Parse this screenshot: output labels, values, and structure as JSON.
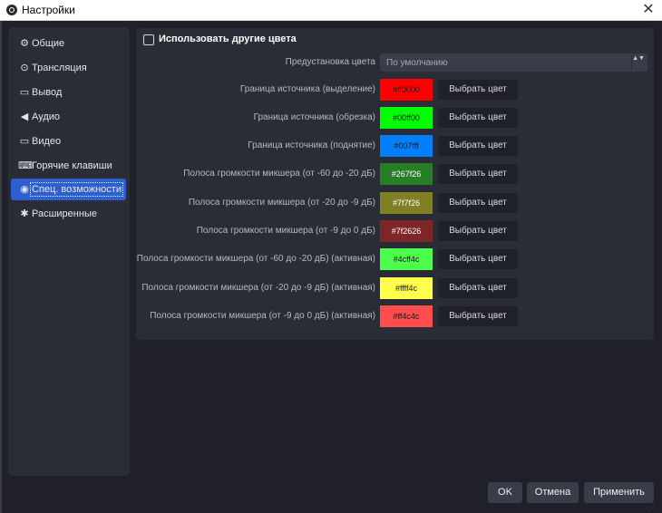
{
  "window": {
    "title": "Настройки",
    "close_glyph": "✕"
  },
  "sidebar": {
    "items": [
      {
        "label": "Общие",
        "icon": "gear-icon",
        "glyph": "⚙"
      },
      {
        "label": "Трансляция",
        "icon": "broadcast-icon",
        "glyph": "⊙"
      },
      {
        "label": "Вывод",
        "icon": "output-icon",
        "glyph": "▭"
      },
      {
        "label": "Аудио",
        "icon": "speaker-icon",
        "glyph": "◀"
      },
      {
        "label": "Видео",
        "icon": "monitor-icon",
        "glyph": "▭"
      },
      {
        "label": "Горячие клавиши",
        "icon": "keyboard-icon",
        "glyph": "⌨"
      },
      {
        "label": "Спец. возможности",
        "icon": "accessibility-icon",
        "glyph": "◉",
        "active": true
      },
      {
        "label": "Расширенные",
        "icon": "wrench-icon",
        "glyph": "✱"
      }
    ]
  },
  "panel": {
    "use_custom_colors_label": "Использовать другие цвета",
    "use_custom_colors_checked": false,
    "preset_label": "Предустановка цвета",
    "preset_value": "По умолчанию",
    "preset_arrows": "▲▼",
    "pick_button_label": "Выбрать цвет",
    "rows": [
      {
        "label": "Граница источника (выделение)",
        "hex": "#ff0000",
        "text_color": "#1a1a1a"
      },
      {
        "label": "Граница источника (обрезка)",
        "hex": "#00ff00",
        "text_color": "#1a1a1a"
      },
      {
        "label": "Граница источника (поднятие)",
        "hex": "#007fff",
        "text_color": "#1a1a1a"
      },
      {
        "label": "Полоса громкости микшера (от -60 до -20 дБ)",
        "hex": "#267f26",
        "text_color": "#ffffff"
      },
      {
        "label": "Полоса громкости микшера (от -20 до -9 дБ)",
        "hex": "#7f7f26",
        "text_color": "#ffffff"
      },
      {
        "label": "Полоса громкости микшера (от -9 до 0 дБ)",
        "hex": "#7f2626",
        "text_color": "#ffffff"
      },
      {
        "label": "Полоса громкости микшера (от -60 до -20 дБ) (активная)",
        "hex": "#4cff4c",
        "text_color": "#1a1a1a"
      },
      {
        "label": "Полоса громкости микшера (от -20 до -9 дБ) (активная)",
        "hex": "#ffff4c",
        "text_color": "#1a1a1a"
      },
      {
        "label": "Полоса громкости микшера (от -9 до 0 дБ) (активная)",
        "hex": "#ff4c4c",
        "text_color": "#1a1a1a"
      }
    ]
  },
  "footer": {
    "ok_label": "OK",
    "cancel_label": "Отмена",
    "apply_label": "Применить"
  }
}
